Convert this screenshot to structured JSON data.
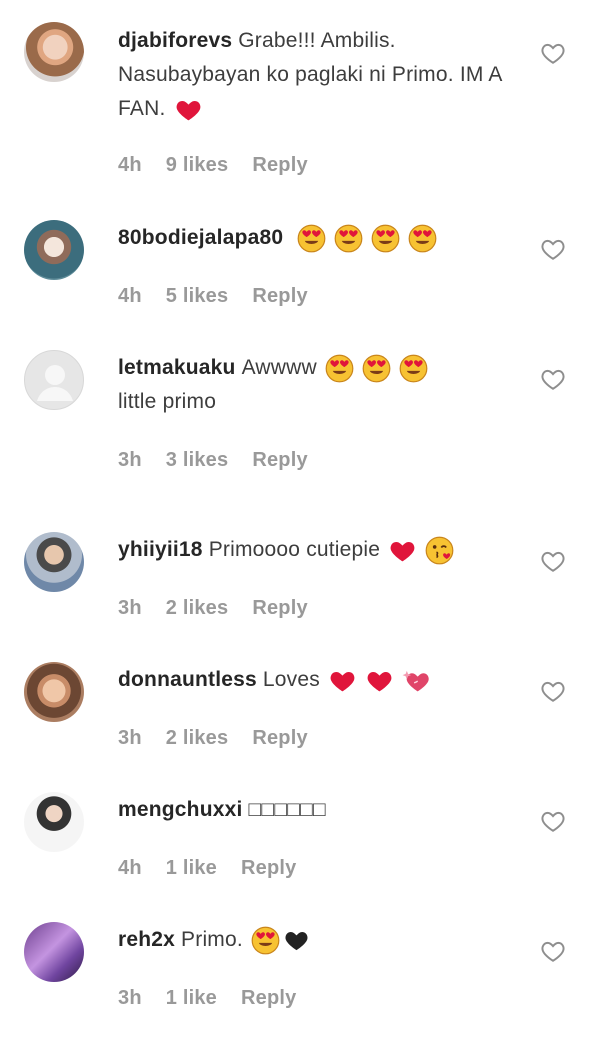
{
  "comments": [
    {
      "username": "djabiforevs",
      "text": "Grabe!!! Ambilis. Nasubaybayan ko paglaki ni Primo. IM A FAN.",
      "emojis": [
        "red-heart"
      ],
      "time": "4h",
      "likes": "9 likes",
      "reply": "Reply"
    },
    {
      "username": "80bodiejalapa80",
      "text": "",
      "emojis": [
        "heart-eyes",
        "heart-eyes",
        "heart-eyes",
        "heart-eyes"
      ],
      "time": "4h",
      "likes": "5 likes",
      "reply": "Reply"
    },
    {
      "username": "letmakuaku",
      "text": "Awwww",
      "text2": "little primo",
      "emojis": [
        "heart-eyes",
        "heart-eyes",
        "heart-eyes"
      ],
      "time": "3h",
      "likes": "3 likes",
      "reply": "Reply"
    },
    {
      "username": "yhiiyii18",
      "text": "Primoooo cutiepie",
      "emojis": [
        "red-heart",
        "kissing-wink"
      ],
      "time": "3h",
      "likes": "2 likes",
      "reply": "Reply"
    },
    {
      "username": "donnauntless",
      "text": "Loves",
      "emojis": [
        "red-heart",
        "red-heart",
        "sparkling-heart"
      ],
      "time": "3h",
      "likes": "2 likes",
      "reply": "Reply"
    },
    {
      "username": "mengchuxxi",
      "text": "□□□□□□",
      "emojis": [],
      "time": "4h",
      "likes": "1 like",
      "reply": "Reply"
    },
    {
      "username": "reh2x",
      "text": "Primo.",
      "emojis": [
        "heart-eyes",
        "black-heart"
      ],
      "time": "3h",
      "likes": "1 like",
      "reply": "Reply"
    }
  ],
  "colors": {
    "text": "#262626",
    "meta": "#999999",
    "heart_red": "#e0153b",
    "emoji_yellow": "#f7c232"
  }
}
